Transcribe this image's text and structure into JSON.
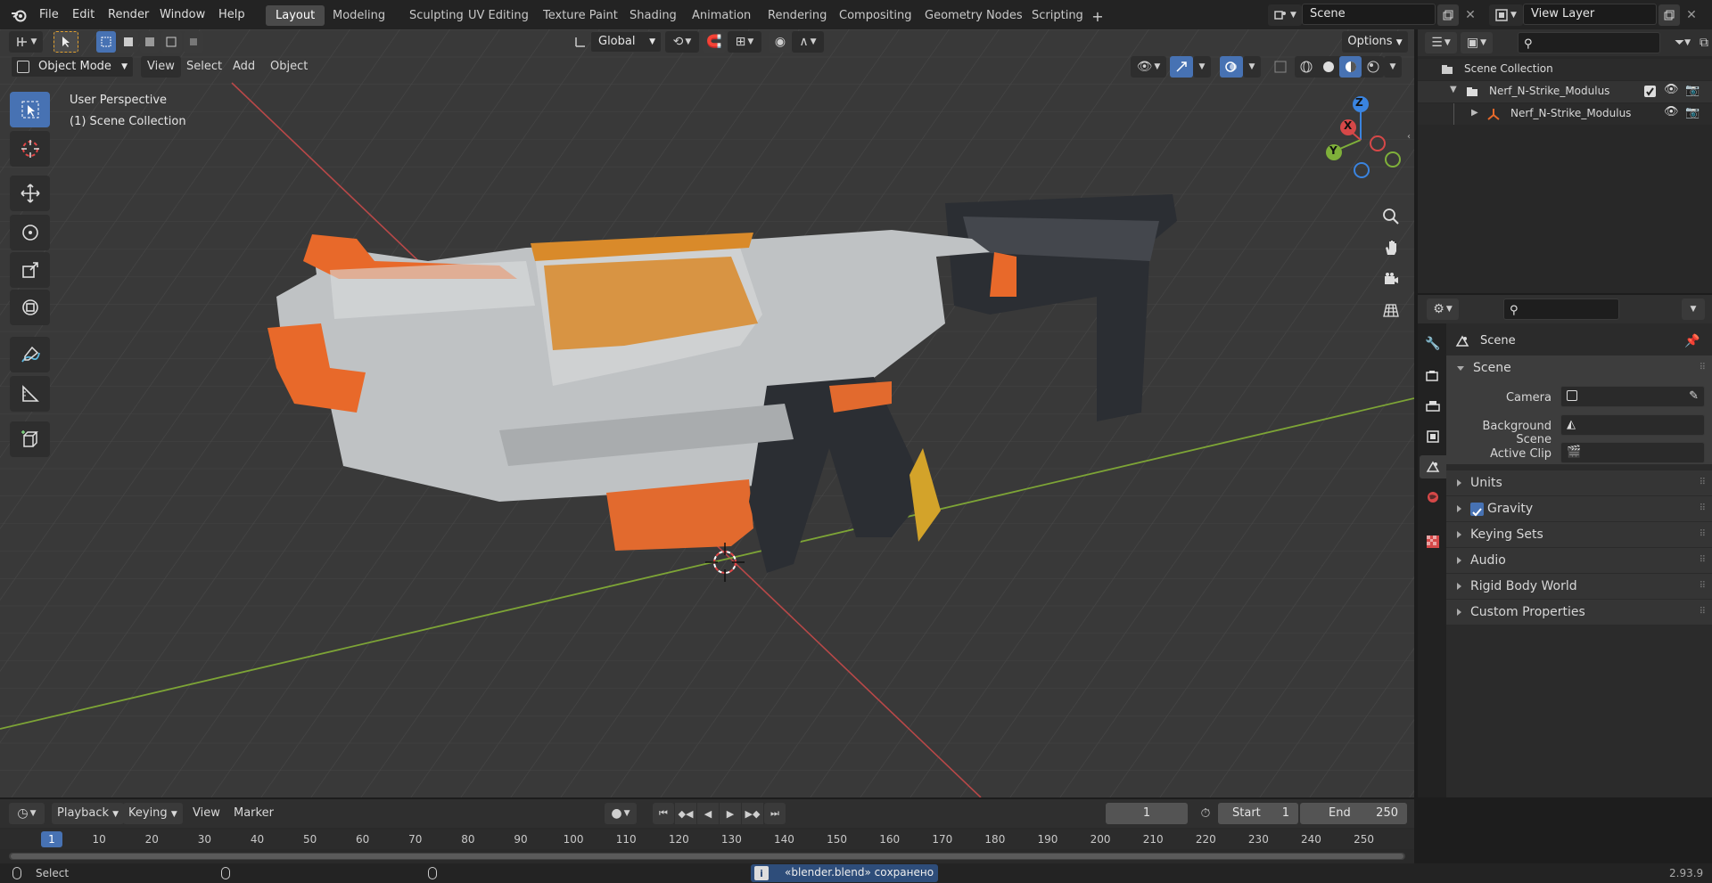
{
  "menu": [
    "File",
    "Edit",
    "Render",
    "Window",
    "Help"
  ],
  "workspaces": [
    "Layout",
    "Modeling",
    "Sculpting",
    "UV Editing",
    "Texture Paint",
    "Shading",
    "Animation",
    "Rendering",
    "Compositing",
    "Geometry Nodes",
    "Scripting"
  ],
  "active_workspace": "Layout",
  "scene_field": "Scene",
  "view_layer_field": "View Layer",
  "header": {
    "transform_orientation": "Global",
    "options_label": "Options",
    "mode": "Object Mode",
    "view_menu": [
      "View",
      "Select",
      "Add",
      "Object"
    ]
  },
  "viewport": {
    "line1": "User Perspective",
    "line2": "(1) Scene Collection",
    "gizmo": {
      "z": "Z",
      "y": "Y",
      "x": "X"
    }
  },
  "outliner": {
    "root": "Scene Collection",
    "collection": "Nerf_N-Strike_Modulus",
    "object": "Nerf_N-Strike_Modulus"
  },
  "properties": {
    "context": "Scene",
    "section": "Scene",
    "camera_label": "Camera",
    "background_label": "Background Scene",
    "clip_label": "Active Clip",
    "panels": [
      "Units",
      "Gravity",
      "Keying Sets",
      "Audio",
      "Rigid Body World",
      "Custom Properties"
    ],
    "gravity_checked": true
  },
  "timeline": {
    "menus": [
      "Playback",
      "Keying",
      "View",
      "Marker"
    ],
    "current_frame": "1",
    "start_label": "Start",
    "start": "1",
    "end_label": "End",
    "end": "250",
    "ticks": [
      "1",
      "10",
      "20",
      "30",
      "40",
      "50",
      "60",
      "70",
      "80",
      "90",
      "100",
      "110",
      "120",
      "130",
      "140",
      "150",
      "160",
      "170",
      "180",
      "190",
      "200",
      "210",
      "220",
      "230",
      "240",
      "250"
    ]
  },
  "status": {
    "select": "Select",
    "message": "«blender.blend» сохранено",
    "version": "2.93.9"
  },
  "colors": {
    "accent": "#4772b3",
    "orange": "#e8692a",
    "x_axis": "#d64848",
    "y_axis": "#7fb03a",
    "z_axis": "#3a84e0"
  }
}
